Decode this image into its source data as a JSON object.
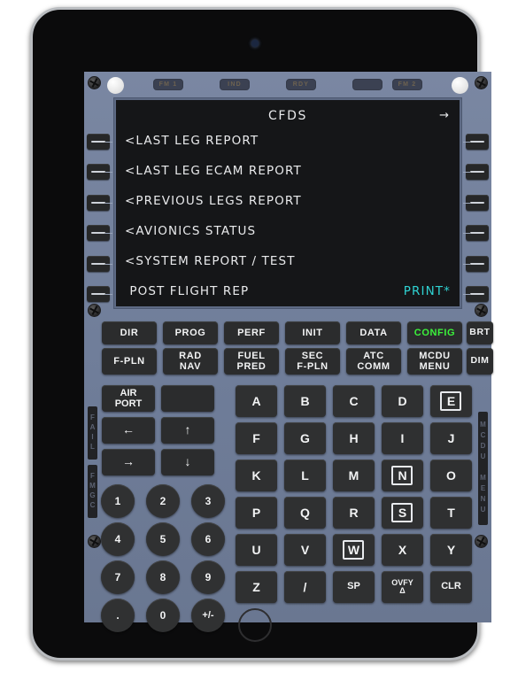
{
  "device": {
    "name": "tablet-frame",
    "camera": "camera-lens",
    "home": "home-button"
  },
  "mcdu": {
    "annunciators": [
      {
        "label": "FM 1"
      },
      {
        "label": "IND"
      },
      {
        "label": "RDY"
      },
      {
        "label": ""
      },
      {
        "label": "FM 2"
      }
    ],
    "screen": {
      "title": "CFDS",
      "page_arrow": "→",
      "lines": [
        {
          "left": "<LAST LEG REPORT",
          "right": ""
        },
        {
          "left": "<LAST LEG ECAM REPORT",
          "right": ""
        },
        {
          "left": "<PREVIOUS LEGS REPORT",
          "right": ""
        },
        {
          "left": "<AVIONICS STATUS",
          "right": ""
        },
        {
          "left": "<SYSTEM REPORT / TEST",
          "right": ""
        },
        {
          "left": " POST FLIGHT REP",
          "right": "PRINT*"
        }
      ],
      "accent_cyan": "#2fd3d3",
      "text_color": "#e9eaec",
      "background": "#151618"
    },
    "function_keys_row1": [
      {
        "label": "DIR",
        "active": false
      },
      {
        "label": "PROG",
        "active": false
      },
      {
        "label": "PERF",
        "active": false
      },
      {
        "label": "INIT",
        "active": false
      },
      {
        "label": "DATA",
        "active": false
      },
      {
        "label": "CONFIG",
        "active": true
      }
    ],
    "function_keys_row2": [
      {
        "line1": "F-PLN",
        "line2": ""
      },
      {
        "line1": "RAD",
        "line2": "NAV"
      },
      {
        "line1": "FUEL",
        "line2": "PRED"
      },
      {
        "line1": "SEC",
        "line2": "F-PLN"
      },
      {
        "line1": "ATC",
        "line2": "COMM"
      },
      {
        "line1": "MCDU",
        "line2": "MENU"
      }
    ],
    "brightness_keys": [
      {
        "label": "BRT"
      },
      {
        "label": "DIM"
      }
    ],
    "left_block": [
      {
        "line1": "AIR",
        "line2": "PORT"
      },
      {
        "line1": "",
        "line2": ""
      },
      {
        "line1": "←",
        "line2": ""
      },
      {
        "line1": "↑",
        "line2": ""
      },
      {
        "line1": "→",
        "line2": ""
      },
      {
        "line1": "↓",
        "line2": ""
      }
    ],
    "numeric_keys": [
      "1",
      "2",
      "3",
      "4",
      "5",
      "6",
      "7",
      "8",
      "9",
      ".",
      "0",
      "+/-"
    ],
    "alpha_keys": [
      {
        "label": "A",
        "sub": "",
        "selected": false
      },
      {
        "label": "B",
        "sub": "",
        "selected": false
      },
      {
        "label": "C",
        "sub": "",
        "selected": false
      },
      {
        "label": "D",
        "sub": "",
        "selected": false
      },
      {
        "label": "E",
        "sub": "",
        "selected": true
      },
      {
        "label": "F",
        "sub": "",
        "selected": false
      },
      {
        "label": "G",
        "sub": "",
        "selected": false
      },
      {
        "label": "H",
        "sub": "",
        "selected": false
      },
      {
        "label": "I",
        "sub": "",
        "selected": false
      },
      {
        "label": "J",
        "sub": "",
        "selected": false
      },
      {
        "label": "K",
        "sub": "",
        "selected": false
      },
      {
        "label": "L",
        "sub": "",
        "selected": false
      },
      {
        "label": "M",
        "sub": "",
        "selected": false
      },
      {
        "label": "N",
        "sub": "",
        "selected": true
      },
      {
        "label": "O",
        "sub": "",
        "selected": false
      },
      {
        "label": "P",
        "sub": "",
        "selected": false
      },
      {
        "label": "Q",
        "sub": "",
        "selected": false
      },
      {
        "label": "R",
        "sub": "",
        "selected": false
      },
      {
        "label": "S",
        "sub": "",
        "selected": true
      },
      {
        "label": "T",
        "sub": "",
        "selected": false
      },
      {
        "label": "U",
        "sub": "",
        "selected": false
      },
      {
        "label": "V",
        "sub": "",
        "selected": false
      },
      {
        "label": "W",
        "sub": "",
        "selected": true
      },
      {
        "label": "X",
        "sub": "",
        "selected": false
      },
      {
        "label": "Y",
        "sub": "",
        "selected": false
      },
      {
        "label": "Z",
        "sub": "",
        "selected": false
      },
      {
        "label": "/",
        "sub": "",
        "selected": false
      },
      {
        "label": "SP",
        "sub": "",
        "selected": false,
        "small": true
      },
      {
        "label": "OVFY",
        "sub": "Δ",
        "selected": false,
        "small": true
      },
      {
        "label": "CLR",
        "sub": "",
        "selected": false,
        "small": true
      }
    ],
    "edge_labels": {
      "left_fail": "FAIL",
      "left_unit": "FMGC",
      "right_menu": "MCDU MENU"
    }
  }
}
